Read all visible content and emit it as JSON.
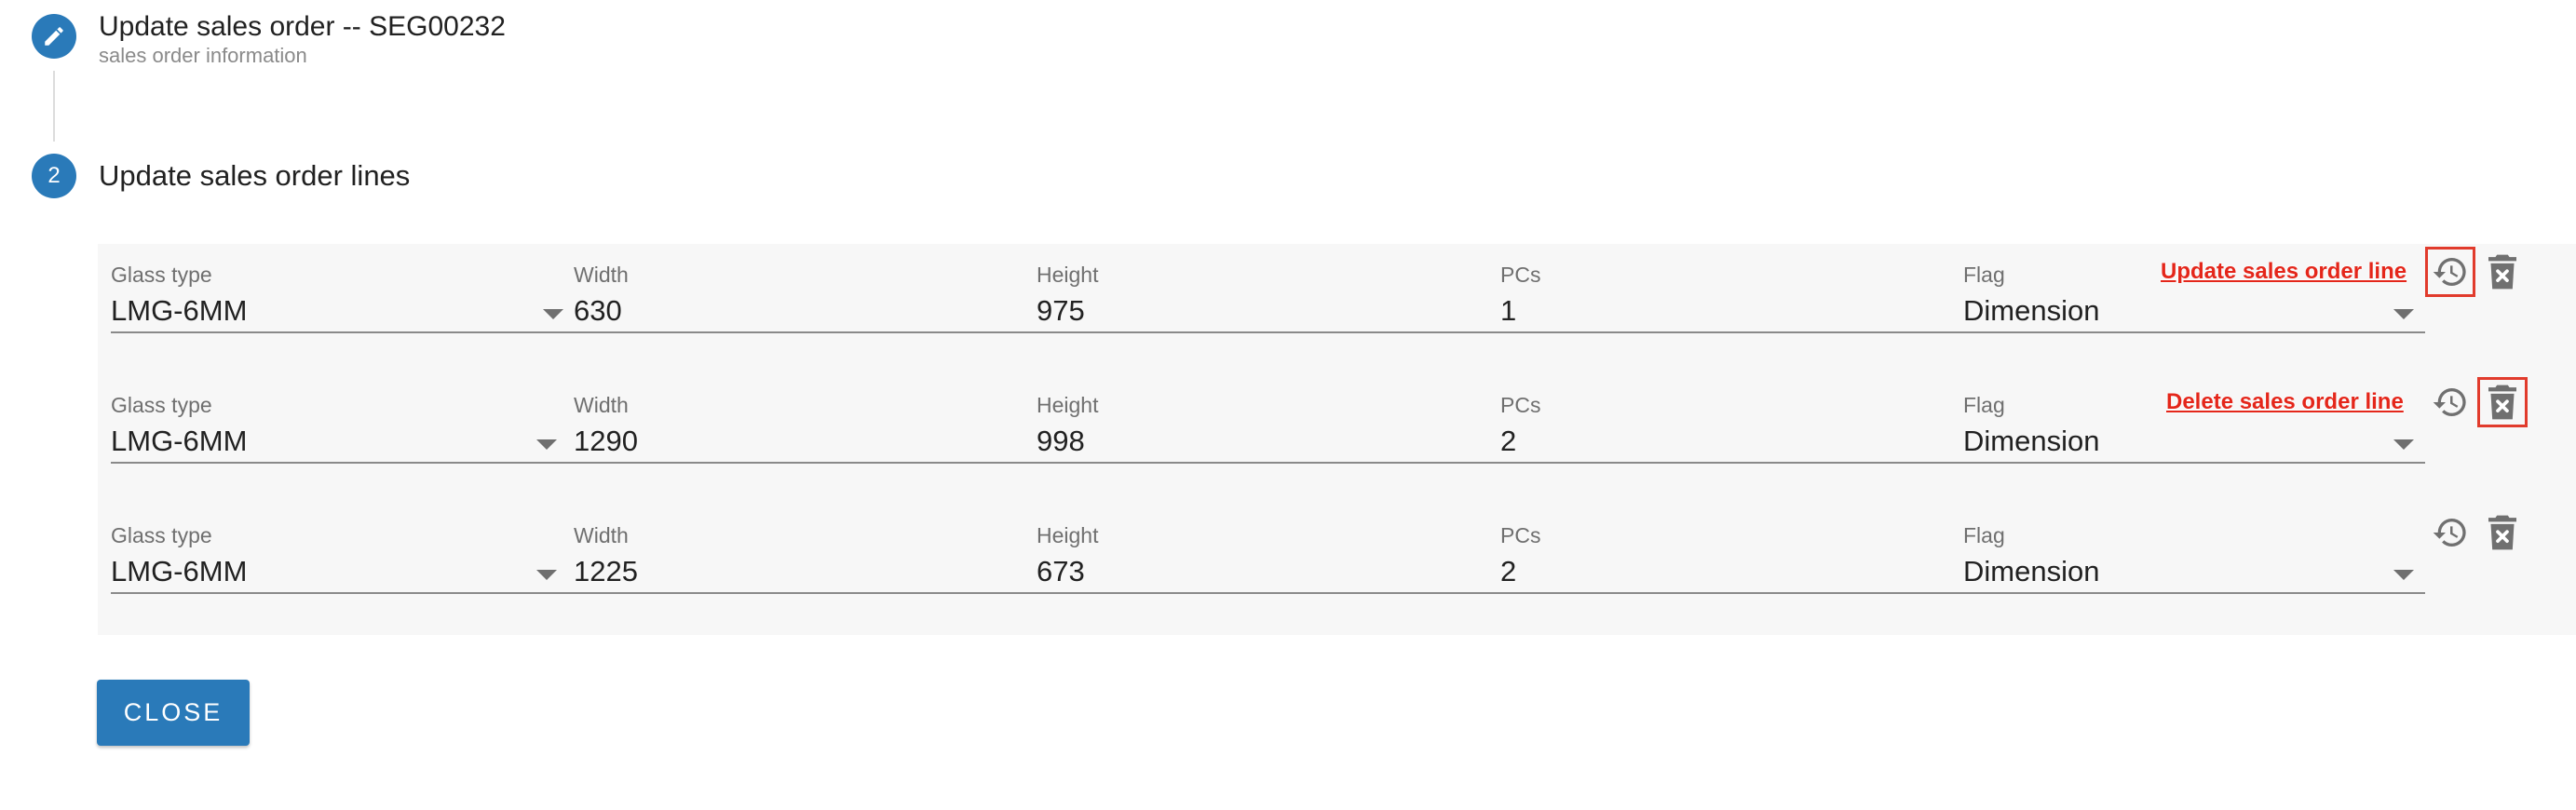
{
  "step1": {
    "title": "Update sales order -- SEG00232",
    "subtitle": "sales order information",
    "icon": "pencil-icon"
  },
  "step2": {
    "number": "2",
    "title": "Update sales order lines"
  },
  "columns": {
    "glass_type": "Glass type",
    "width": "Width",
    "height": "Height",
    "pcs": "PCs",
    "flag": "Flag"
  },
  "lines": [
    {
      "glass_type": "LMG-6MM",
      "width": "630",
      "height": "975",
      "pcs": "1",
      "flag": "Dimension"
    },
    {
      "glass_type": "LMG-6MM",
      "width": "1290",
      "height": "998",
      "pcs": "2",
      "flag": "Dimension"
    },
    {
      "glass_type": "LMG-6MM",
      "width": "1225",
      "height": "673",
      "pcs": "2",
      "flag": "Dimension"
    }
  ],
  "annotations": {
    "update_line": "Update sales order line",
    "delete_line": "Delete sales order line"
  },
  "actions": {
    "close_label": "CLOSE"
  },
  "colors": {
    "primary": "#2a7ab9",
    "annotation": "#e4261a",
    "panel_bg": "#f7f7f7"
  }
}
